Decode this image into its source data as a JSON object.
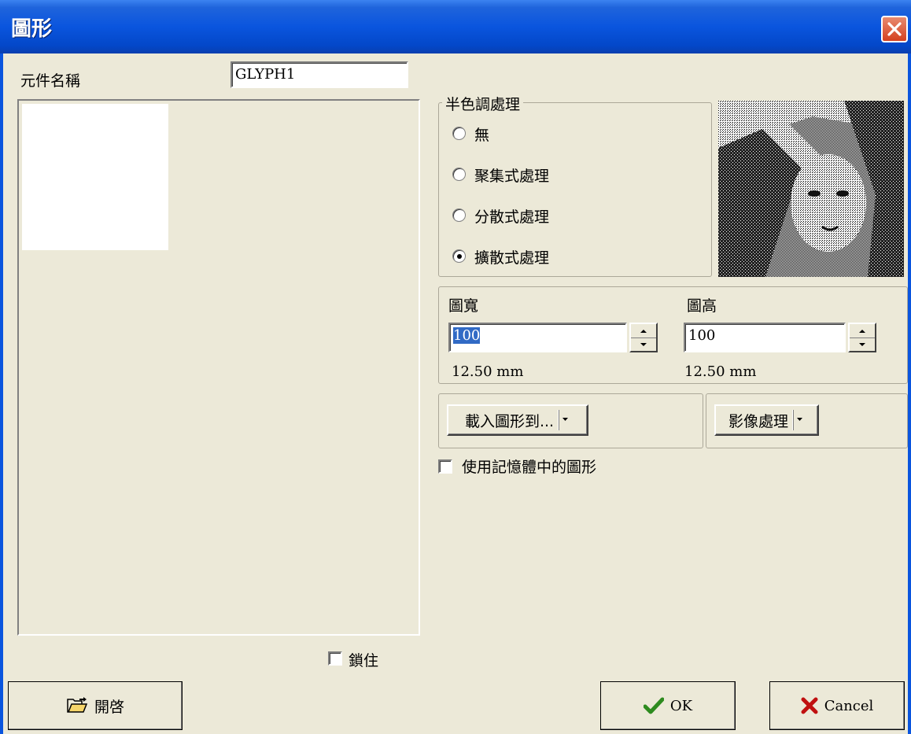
{
  "window": {
    "title": "圖形"
  },
  "component_name": {
    "label": "元件名稱",
    "value": "GLYPH1"
  },
  "halftone": {
    "legend": "半色調處理",
    "options": [
      "無",
      "聚集式處理",
      "分散式處理",
      "擴散式處理"
    ],
    "selected": "擴散式處理"
  },
  "size": {
    "width": {
      "label": "圖寬",
      "value": "100",
      "mm": "12.50 mm"
    },
    "height": {
      "label": "圖高",
      "value": "100",
      "mm": "12.50 mm"
    }
  },
  "buttons": {
    "load_to": "載入圖形到...",
    "image_processing": "影像處理",
    "open": "開啓",
    "ok": "OK",
    "cancel": "Cancel"
  },
  "checkboxes": {
    "use_memory": {
      "label": "使用記憶體中的圖形",
      "checked": false
    },
    "lock": {
      "label": "鎖住",
      "checked": false
    }
  },
  "icons": {
    "close": "close-icon",
    "open": "folder-open-icon",
    "ok": "checkmark-icon",
    "cancel": "x-icon"
  },
  "colors": {
    "titlebar": "#0a55de",
    "dialog_bg": "#ece9d8",
    "ok_check": "#2e8b1f",
    "cancel_x": "#c01010"
  }
}
